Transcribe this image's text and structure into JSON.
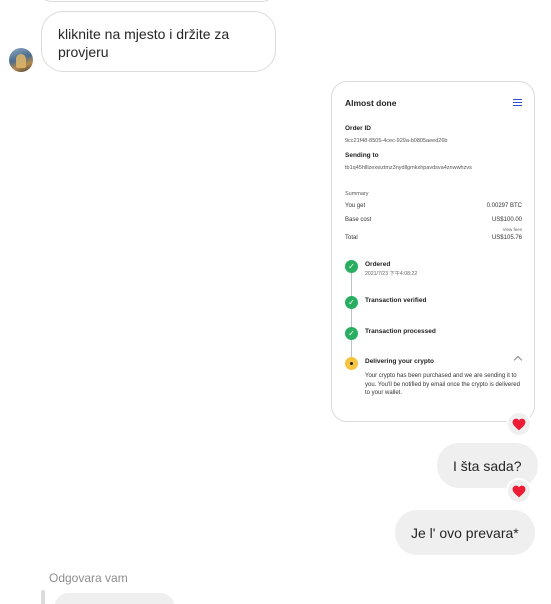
{
  "incoming_message": {
    "text": "kliknite na mjesto i držite za provjeru"
  },
  "receipt_card": {
    "title": "Almost done",
    "order_id_label": "Order ID",
    "order_id": "9cc21f48-8505-4cec-929a-b0805aeed26b",
    "sending_to_label": "Sending to",
    "sending_to": "tb1q45hlllzexwztmz3nydllgmkxhpavdsva4znwwhzvs",
    "summary_label": "Summary",
    "you_get_label": "You get",
    "you_get_value": "0.00297 BTC",
    "base_cost_label": "Base cost",
    "base_cost_value": "US$100.00",
    "view_fees": "View fees",
    "total_label": "Total",
    "total_value": "US$105.76",
    "steps": [
      {
        "title": "Ordered",
        "subtitle": "2021/7/23 下午4:08:22",
        "status": "done"
      },
      {
        "title": "Transaction verified",
        "status": "done"
      },
      {
        "title": "Transaction processed",
        "status": "done"
      },
      {
        "title": "Delivering your crypto",
        "status": "pending",
        "description": "Your crypto has been purchased and we are sending it to you. You'll be notified by email once the crypto is delivered to your wallet."
      }
    ]
  },
  "outgoing_messages": [
    {
      "text": "I šta sada?"
    },
    {
      "text": "Je l' ovo prevara*"
    }
  ],
  "reply": {
    "label": "Odgovara vam"
  },
  "icons": {
    "reaction": "heart-icon",
    "menu": "hamburger-menu-icon",
    "step_done": "check-circle-icon",
    "step_pending": "pending-dot-icon",
    "collapse": "chevron-up-icon"
  },
  "colors": {
    "heart": "#ed1b35",
    "step_done": "#27ae60",
    "step_pending": "#f5c542",
    "menu_accent": "#2d4fd0",
    "bubble_out": "#efefef",
    "border": "#dbdbdb"
  }
}
